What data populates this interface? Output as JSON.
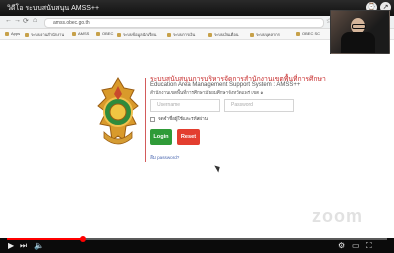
{
  "video": {
    "title": "วิดีโอ ระบบสนับสนุน AMSS++",
    "progress_fraction": 0.2
  },
  "browser": {
    "url": "amss.obec.go.th",
    "bookmarks": [
      "Apps",
      "ระบบงานสำนักงาน",
      "AMSS",
      "OBEC",
      "ระบบข้อมูลนักเรียน",
      "ระบบการเงิน",
      "ระบบเงินเดือน",
      "ระบบบุคลากร",
      "OBEC SC"
    ]
  },
  "login": {
    "title_th": "ระบบสนับสนุนการบริหารจัดการสำนักงานเขตพื้นที่การศึกษา",
    "title_en": "Education Area Management Support System : AMSS++",
    "subtitle": "สำนักงานเขตพื้นที่การศึกษามัธยมศึกษาจังหวัดแพร่ เขต ๑",
    "username_placeholder": "Username",
    "password_placeholder": "Password",
    "remember_label": "จดจำชื่อผู้ใช้และรหัสผ่าน",
    "login_label": "Login",
    "reset_label": "Reset",
    "forgot_link": "ลืม password?"
  },
  "watermark": {
    "text": "zoom"
  },
  "colors": {
    "accent_red": "#c62828",
    "login_green": "#2f9b38",
    "reset_red": "#e33e2f",
    "progress_red": "#ff0000"
  }
}
